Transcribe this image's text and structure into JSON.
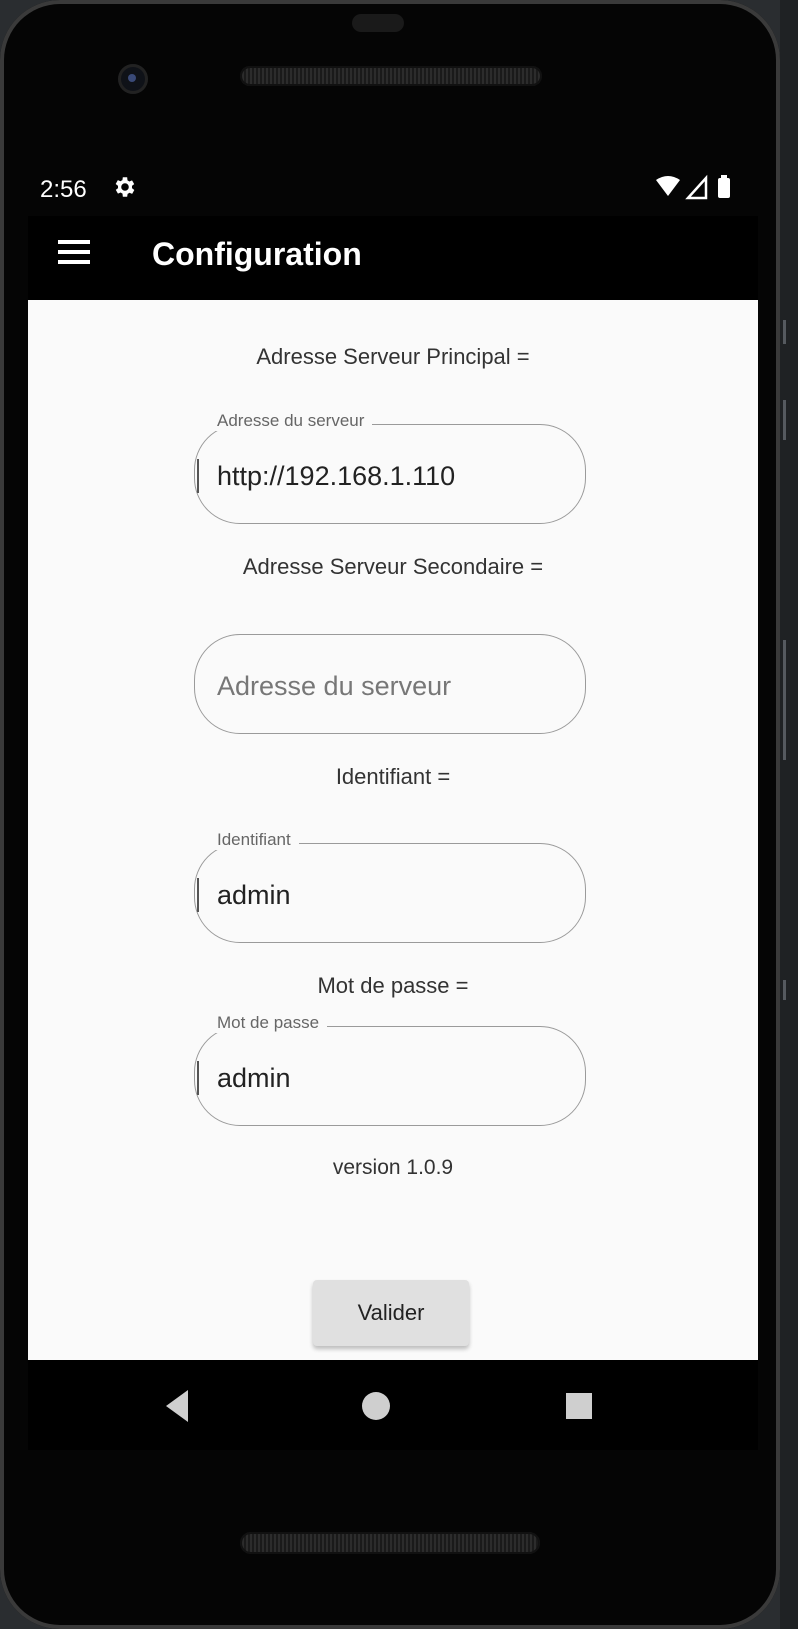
{
  "status_bar": {
    "time": "2:56",
    "icons": [
      "settings-icon",
      "wifi-icon",
      "signal-icon",
      "battery-icon"
    ]
  },
  "app_bar": {
    "title": "Configuration",
    "menu_icon": "hamburger-menu-icon"
  },
  "form": {
    "primary_label": "Adresse Serveur Principal =",
    "primary_field": {
      "legend": "Adresse du serveur",
      "value": "http://192.168.1.110"
    },
    "secondary_label": "Adresse Serveur Secondaire =",
    "secondary_field": {
      "placeholder": "Adresse du serveur",
      "value": ""
    },
    "username_label": "Identifiant =",
    "username_field": {
      "legend": "Identifiant",
      "value": "admin"
    },
    "password_label": "Mot de passe =",
    "password_field": {
      "legend": "Mot de passe",
      "value": "admin"
    },
    "version": "version 1.0.9",
    "submit_label": "Valider"
  },
  "nav_bar": {
    "icons": [
      "back-icon",
      "home-icon",
      "recents-icon"
    ]
  },
  "colors": {
    "app_bar_bg": "#000000",
    "content_bg": "#fafafa",
    "button_bg": "#e0e0e0",
    "field_border": "#9a9a9a"
  }
}
